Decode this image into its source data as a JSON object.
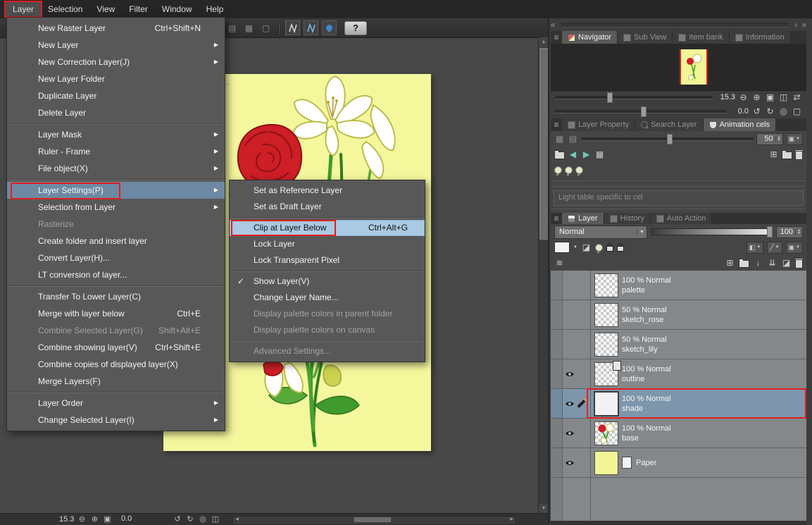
{
  "icons": {
    "submenu_arrow": "▶",
    "checkmark": "✓",
    "dropdown": "▼",
    "up": "▲",
    "down": "▼",
    "collapse": "«",
    "chev_left": "‹",
    "chev_right": "›",
    "chev_double": "»",
    "zoom_out": "⊖",
    "zoom_in": "⊕",
    "actual_size": "▣",
    "fit_screen": "◫",
    "flip_h": "⇄",
    "rotate_left": "↺",
    "rotate_right": "↻",
    "reset_rotation": "◎",
    "blank_square": "▢",
    "menu_list": "≡",
    "grid": "▦",
    "panel_rows": "▤",
    "panel_cols": "▥",
    "new_layer": "⊞",
    "transfer_down": "↓",
    "merge_down": "⇊",
    "layer_mask": "◪",
    "wave": "≋",
    "arrow_left": "◀",
    "arrow_right": "▶",
    "diag": "╱",
    "half_square": "◧",
    "scroll_up": "▲",
    "scroll_down": "▼",
    "scroll_left": "◀",
    "scroll_right": "▶"
  },
  "menubar": {
    "items": [
      "Layer",
      "Selection",
      "View",
      "Filter",
      "Window",
      "Help"
    ]
  },
  "toolbar": {
    "help_label": "?"
  },
  "canvas": {
    "handwriting": "b/05-"
  },
  "layer_menu": {
    "items": [
      {
        "label": "New Raster Layer",
        "shortcut": "Ctrl+Shift+N"
      },
      {
        "label": "New Layer"
      },
      {
        "label": "New Correction Layer(J)"
      },
      {
        "label": "New Layer Folder"
      },
      {
        "label": "Duplicate Layer"
      },
      {
        "label": "Delete Layer"
      },
      {
        "label": "Layer Mask"
      },
      {
        "label": "Ruler - Frame"
      },
      {
        "label": "File object(X)"
      },
      {
        "label": "Layer Settings(P)"
      },
      {
        "label": "Selection from Layer"
      },
      {
        "label": "Rasterize"
      },
      {
        "label": "Create folder and insert layer"
      },
      {
        "label": "Convert Layer(H)..."
      },
      {
        "label": "LT conversion of layer..."
      },
      {
        "label": "Transfer To Lower Layer(C)"
      },
      {
        "label": "Merge with layer below",
        "shortcut": "Ctrl+E"
      },
      {
        "label": "Combine Selected Layer(G)",
        "shortcut": "Shift+Alt+E"
      },
      {
        "label": "Combine showing layer(V)",
        "shortcut": "Ctrl+Shift+E"
      },
      {
        "label": "Combine copies of displayed layer(X)"
      },
      {
        "label": "Merge Layers(F)"
      },
      {
        "label": "Layer Order"
      },
      {
        "label": "Change Selected Layer(I)"
      }
    ]
  },
  "layer_settings_submenu": {
    "items": [
      {
        "label": "Set as Reference Layer"
      },
      {
        "label": "Set as Draft Layer"
      },
      {
        "label": "Clip at Layer Below",
        "shortcut": "Ctrl+Alt+G"
      },
      {
        "label": "Lock Layer"
      },
      {
        "label": "Lock Transparent Pixel"
      },
      {
        "label": "Show Layer(V)"
      },
      {
        "label": "Change Layer Name..."
      },
      {
        "label": "Display palette colors in parent folder"
      },
      {
        "label": "Display palette colors on canvas"
      },
      {
        "label": "Advanced Settings..."
      }
    ]
  },
  "navigator": {
    "tabs": [
      "Navigator",
      "Sub View",
      "Item bank",
      "Information"
    ],
    "zoom_value": "15.3",
    "rotate_value": "0.0"
  },
  "middle_tabs": [
    "Layer Property",
    "Search Layer",
    "Animation cels"
  ],
  "animation_cels": {
    "opacity_value": "50",
    "light_table_text": "Light table specific to cel"
  },
  "bottom_tabs": [
    "Layer",
    "History",
    "Auto Action"
  ],
  "layer_panel": {
    "blend_mode": "Normal",
    "opacity_value": "100",
    "layers": [
      {
        "info": "100 % Normal",
        "name": "palette"
      },
      {
        "info": "50 % Normal",
        "name": "sketch_rose"
      },
      {
        "info": "50 % Normal",
        "name": "sketch_lily"
      },
      {
        "info": "100 % Normal",
        "name": "outline"
      },
      {
        "info": "100 % Normal",
        "name": "shade"
      },
      {
        "info": "100 % Normal",
        "name": "base"
      },
      {
        "name": "Paper"
      }
    ]
  },
  "statusbar": {
    "zoom_value": "15.3",
    "rotate_value": "0.0"
  }
}
